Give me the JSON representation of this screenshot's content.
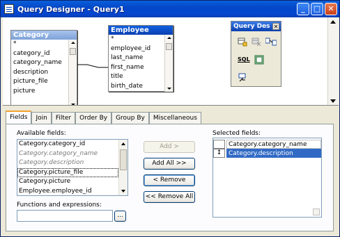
{
  "window": {
    "title": "Query Designer - Query1",
    "minimize_glyph": "_",
    "maximize_glyph": "□",
    "close_glyph": "✕"
  },
  "tables": [
    {
      "name": "Category",
      "fields": [
        "*",
        "category_id",
        "category_name",
        "description",
        "picture_file",
        "picture"
      ]
    },
    {
      "name": "Employee",
      "fields": [
        "*",
        "employee_id",
        "last_name",
        "first_name",
        "title",
        "birth_date"
      ]
    }
  ],
  "toolbox": {
    "title": "Query Des",
    "close_glyph": "✕",
    "tools": [
      "add-table-icon",
      "remove-table-icon",
      "join-icon",
      "sql-icon",
      "form-icon",
      "redirect-icon"
    ],
    "sql_label": "SQL"
  },
  "tabs": [
    "Fields",
    "Join",
    "Filter",
    "Order By",
    "Group By",
    "Miscellaneous"
  ],
  "active_tab": "Fields",
  "fields_tab": {
    "available_label": "Available fields:",
    "available_items": [
      {
        "text": "Category.category_id",
        "dim": false
      },
      {
        "text": "Category.category_name",
        "dim": true
      },
      {
        "text": "Category.description",
        "dim": true
      },
      {
        "text": "Category.picture_file",
        "dim": false,
        "focus": true
      },
      {
        "text": "Category.picture",
        "dim": false
      },
      {
        "text": "Employee.employee_id",
        "dim": false
      }
    ],
    "buttons": {
      "add": "Add >",
      "add_all": "Add All >>",
      "remove": "< Remove",
      "remove_all": "<< Remove All"
    },
    "functions_label": "Functions and expressions:",
    "functions_value": "",
    "ellipsis": "...",
    "selected_label": "Selected fields:",
    "selected_items": [
      {
        "text": "Category.category_name",
        "selected": false,
        "handle": ""
      },
      {
        "text": "Category.description",
        "selected": true,
        "handle": "↕"
      }
    ]
  },
  "colors": {
    "titlebar": "#0448c8",
    "selection": "#316ac5",
    "face": "#ece9d8"
  }
}
